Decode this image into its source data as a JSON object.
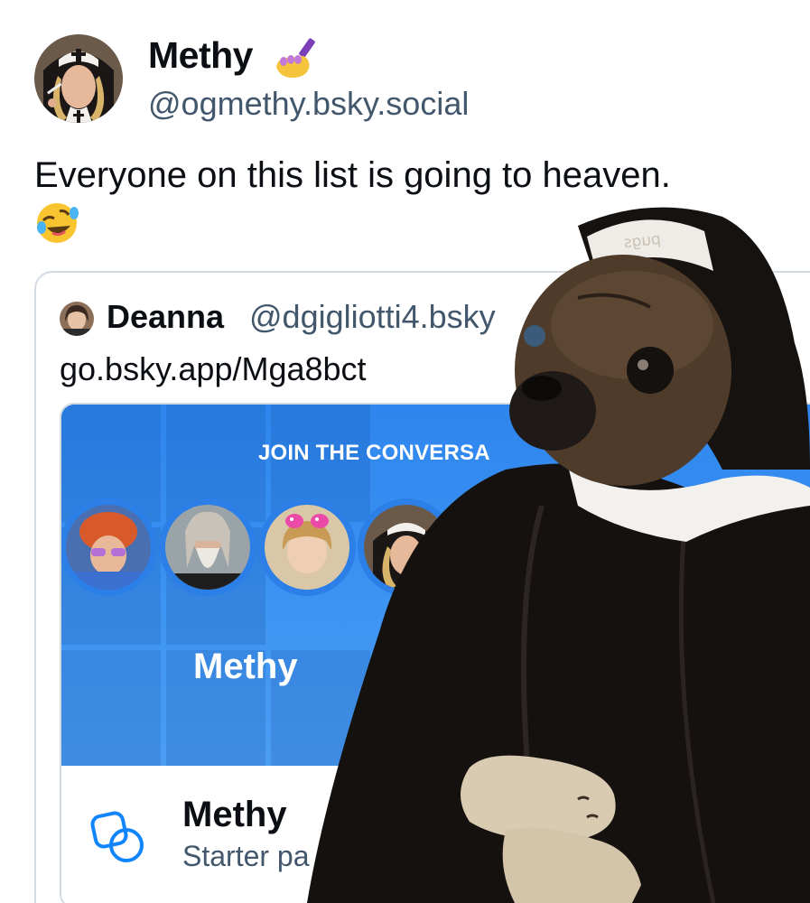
{
  "post": {
    "display_name": "Methy",
    "name_emoji": "nail-polish-emoji",
    "handle": "@ogmethy.bsky.social",
    "text": "Everyone on this list is going to heaven.",
    "text_emoji": "rolling-on-floor-laughing-emoji"
  },
  "quote": {
    "author_name": "Deanna",
    "author_handle": "@dgigliotti4.bsky",
    "text": "go.bsky.app/Mga8bct",
    "link_card": {
      "banner_title": "JOIN THE CONVERSA",
      "banner_name": "Methy",
      "icon": "starter-pack-icon",
      "title": "Methy",
      "subtitle": "Starter pa"
    }
  },
  "overlay": {
    "headband_text": "pugs"
  },
  "colors": {
    "banner_blue": "#3f95f2",
    "muted_text": "#42576c",
    "accent": "#1185fe"
  }
}
